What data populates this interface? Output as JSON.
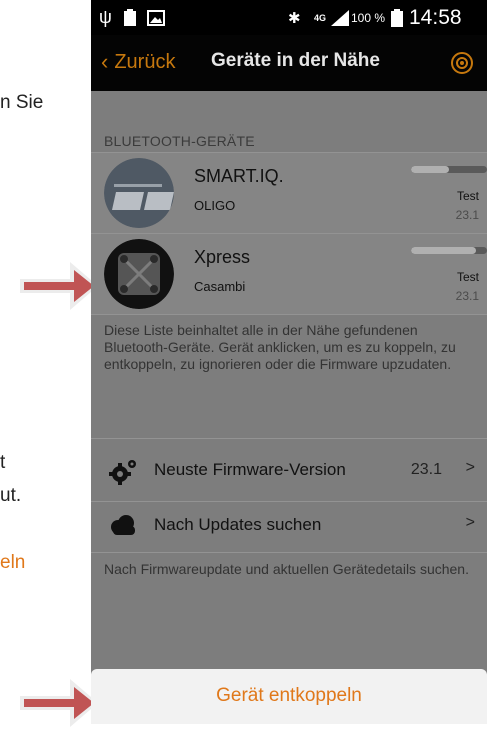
{
  "document_fragments": {
    "line1": "n Sie",
    "line2": "t",
    "line3": "ut.",
    "line4": "eln"
  },
  "status_bar": {
    "battery": "100 %",
    "network": "4G",
    "time": "14:58"
  },
  "action_bar": {
    "back_label": "Zurück",
    "title": "Geräte in der Nähe"
  },
  "bluetooth": {
    "header": "BLUETOOTH-GERÄTE",
    "devices": [
      {
        "name": "SMART.IQ.",
        "vendor": "OLIGO",
        "tag": "Test",
        "version": "23.1",
        "signal": 0.5
      },
      {
        "name": "Xpress",
        "vendor": "Casambi",
        "tag": "Test",
        "version": "23.1",
        "signal": 0.85
      }
    ],
    "description": "Diese Liste beinhaltet alle in der Nähe gefundenen Bluetooth-Geräte. Gerät anklicken, um es zu koppeln, zu entkoppeln, zu ignorieren oder die Firmware upzudaten."
  },
  "firmware": {
    "latest_label": "Neuste Firmware-Version",
    "latest_value": "23.1",
    "updates_label": "Nach Updates suchen",
    "description": "Nach Firmwareupdate und aktuellen Gerätedetails suchen."
  },
  "unpair_label": "Gerät entkoppeln",
  "colors": {
    "accent": "#e0781a",
    "arrow": "#c05454"
  }
}
